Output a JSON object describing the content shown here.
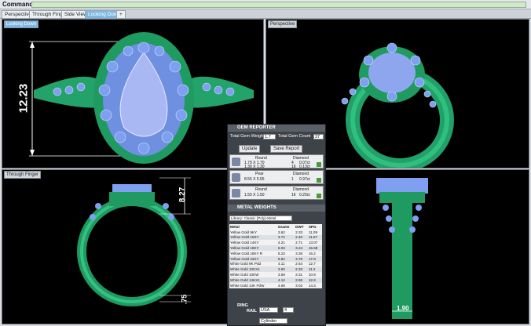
{
  "command": {
    "label": "Command:",
    "value": ""
  },
  "tabs": [
    "Perspective",
    "Through Finger",
    "Side View",
    "Looking Down",
    "+"
  ],
  "viewports": {
    "top_left": {
      "label": "Looking Down",
      "dimension": "12.23"
    },
    "top_right": {
      "label": "Perspective"
    },
    "bottom_left": {
      "label": "Through Finger",
      "dimension_height": "8.27",
      "dimension_thickness": ".75"
    },
    "bottom_right": {
      "dimension": "1.90"
    }
  },
  "gem_reporter": {
    "title": "GEM REPORTER",
    "total_weight_label": "Total Gem Weight",
    "total_weight_value": "1.7",
    "total_count_label": "Total Gem Count",
    "total_count_value": "37",
    "update_label": "Update",
    "save_label": "Save Report",
    "rows": [
      {
        "shape": "Round",
        "material": "Diamond",
        "size1": "1.70 X 1.70",
        "qty1": "4",
        "wt1": "0.07ct",
        "size2": "1.30 X 1.30",
        "qty2": "16",
        "wt2": "0.13ct"
      },
      {
        "shape": "Pear",
        "material": "Diamond",
        "size1": "8.55 X 5.55",
        "qty1": "1",
        "wt1": "0.97ct",
        "size2": "",
        "qty2": "",
        "wt2": ""
      },
      {
        "shape": "Round",
        "material": "Diamond",
        "size1": "1.50 X 1.50",
        "qty1": "16",
        "wt1": "0.20ct",
        "size2": "",
        "qty2": "",
        "wt2": ""
      }
    ]
  },
  "metal_weights": {
    "title": "METAL WEIGHTS",
    "library": "Library: Classic (Poly)-Metal",
    "columns": [
      "Metal",
      "Grams",
      "DWT",
      "SPG"
    ],
    "rows": [
      [
        "Yellow Gold 9KY",
        "3.62",
        "2.33",
        "11.09"
      ],
      [
        "Yellow Gold 10KY",
        "3.74",
        "2.40",
        "11.57"
      ],
      [
        "Yellow Gold 14KY",
        "4.21",
        "2.71",
        "13.07"
      ],
      [
        "Yellow Gold 18KY",
        "5.03",
        "3.24",
        "15.58"
      ],
      [
        "Yellow Gold 18KY R",
        "5.23",
        "3.36",
        "16.2"
      ],
      [
        "Yellow Gold 22KY",
        "5.84",
        "3.76",
        "17.8"
      ],
      [
        "White Gold 9K Pdd",
        "4.11",
        "2.64",
        "12.7"
      ],
      [
        "White Gold 10KX1",
        "3.63",
        "2.33",
        "11.2"
      ],
      [
        "White Gold 10KW",
        "3.59",
        "2.31",
        "10.9"
      ],
      [
        "White Gold 14KX1",
        "4.12",
        "2.65",
        "12.6"
      ],
      [
        "White Gold 14K PdW",
        "4.69",
        "3.02",
        "14.3"
      ]
    ],
    "ring_label": "RING",
    "rail_label": "RAIL",
    "rail_value": "USA",
    "size_value": "4",
    "bottom_label": "Cylinder"
  }
}
